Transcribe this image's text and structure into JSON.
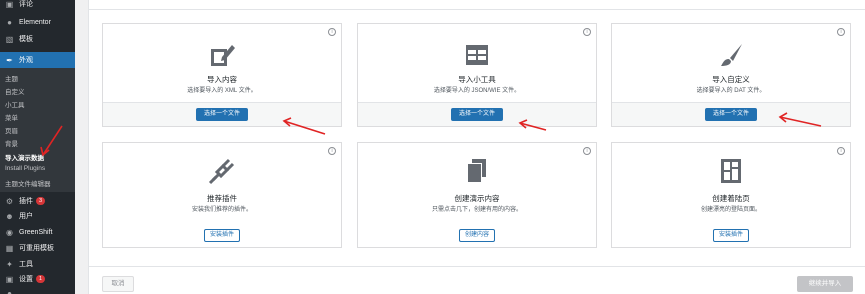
{
  "sidebar": {
    "top_items": [
      {
        "label": "评论",
        "icon": "comment-icon"
      },
      {
        "label": "Elementor",
        "icon": "elementor-icon"
      },
      {
        "label": "模板",
        "icon": "folder-icon"
      },
      {
        "label": "外观",
        "icon": "brush-icon"
      }
    ],
    "submenu": [
      "主题",
      "自定义",
      "小工具",
      "菜单",
      "页眉",
      "背景",
      "导入演示数据",
      "Install Plugins",
      "主题文件编辑器"
    ],
    "current_sub": "导入演示数据",
    "bottom_items": [
      {
        "label": "插件",
        "icon": "plugin-icon",
        "badge": "3"
      },
      {
        "label": "用户",
        "icon": "user-icon",
        "badge": ""
      },
      {
        "label": "GreenShift",
        "icon": "greenshift-icon",
        "badge": ""
      },
      {
        "label": "可重用模板",
        "icon": "reusable-icon",
        "badge": ""
      },
      {
        "label": "工具",
        "icon": "wrench-icon",
        "badge": ""
      },
      {
        "label": "设置",
        "icon": "settings-icon",
        "badge": "1"
      },
      {
        "label": "",
        "icon": "more-icon",
        "badge": ""
      }
    ]
  },
  "cards": [
    {
      "title": "导入内容",
      "desc": "选择要导入的 XML 文件。",
      "button": "选择一个文件",
      "icon": "edit-icon",
      "primary": true
    },
    {
      "title": "导入小工具",
      "desc": "选择要导入的 JSON/WIE 文件。",
      "button": "选择一个文件",
      "icon": "widgets-icon",
      "primary": true
    },
    {
      "title": "导入自定义",
      "desc": "选择要导入的 DAT 文件。",
      "button": "选择一个文件",
      "icon": "brush-icon",
      "primary": true
    },
    {
      "title": "推荐插件",
      "desc": "安装我们推荐的插件。",
      "button": "安装插件",
      "icon": "plugin-icon",
      "primary": false
    },
    {
      "title": "创建演示内容",
      "desc": "只需点击几下，创建有用的内容。",
      "button": "创建内容",
      "icon": "pages-icon",
      "primary": false
    },
    {
      "title": "创建着陆页",
      "desc": "创建漂亮的登陆页面。",
      "button": "安装插件",
      "icon": "layout-icon",
      "primary": false
    }
  ],
  "footer": {
    "cancel": "取消",
    "next": "继续并导入"
  },
  "colors": {
    "primary": "#2271b1",
    "sidebar": "#23282d",
    "arrow": "#e02424"
  }
}
